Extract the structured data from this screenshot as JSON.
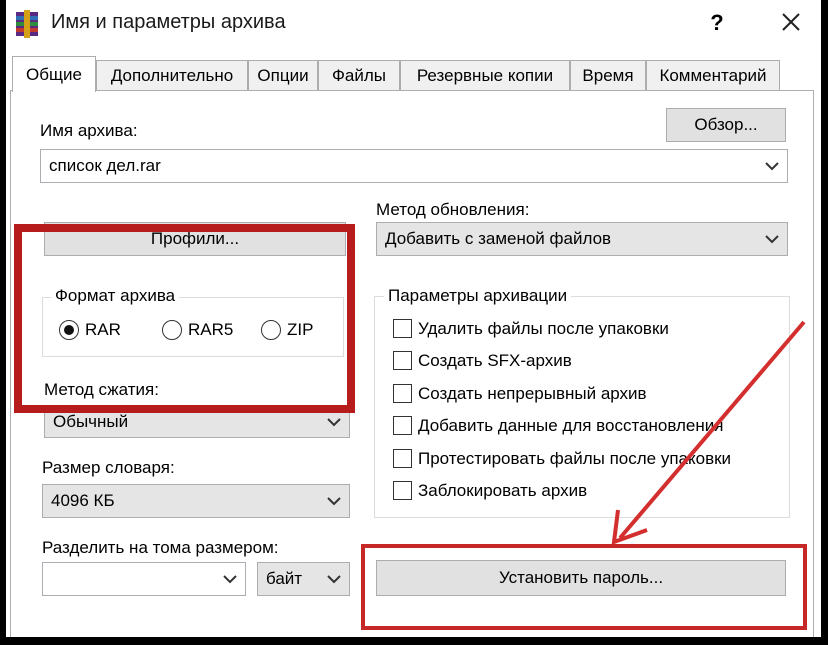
{
  "window": {
    "title": "Имя и параметры архива",
    "help_label": "?"
  },
  "tabs": [
    {
      "label": "Общие",
      "active": true
    },
    {
      "label": "Дополнительно"
    },
    {
      "label": "Опции"
    },
    {
      "label": "Файлы"
    },
    {
      "label": "Резервные копии"
    },
    {
      "label": "Время"
    },
    {
      "label": "Комментарий"
    }
  ],
  "general": {
    "archive_name_label": "Имя архива:",
    "browse_button": "Обзор...",
    "archive_name_value": "список дел.rar",
    "profiles_button": "Профили...",
    "update_method_label": "Метод обновления:",
    "update_method_value": "Добавить с заменой файлов",
    "format_group": {
      "title": "Формат архива",
      "options": [
        "RAR",
        "RAR5",
        "ZIP"
      ],
      "selected": "RAR"
    },
    "compression_label": "Метод сжатия:",
    "compression_value": "Обычный",
    "dictionary_label": "Размер словаря:",
    "dictionary_value": "4096 КБ",
    "split_label": "Разделить на тома размером:",
    "split_value": "",
    "split_unit": "байт",
    "options_group": {
      "title": "Параметры архивации",
      "items": [
        {
          "label": "Удалить файлы после упаковки",
          "checked": false
        },
        {
          "label": "Создать SFX-архив",
          "checked": false
        },
        {
          "label": "Создать непрерывный архив",
          "checked": false
        },
        {
          "label": "Добавить данные для восстановления",
          "checked": false
        },
        {
          "label": "Протестировать файлы после упаковки",
          "checked": false
        },
        {
          "label": "Заблокировать архив",
          "checked": false
        }
      ]
    },
    "set_password_button": "Установить пароль..."
  },
  "colors": {
    "highlight_box": "#b71c1c",
    "arrow": "#d32f2f"
  }
}
